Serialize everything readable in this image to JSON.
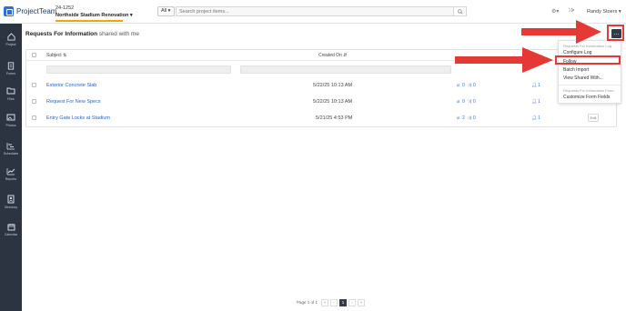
{
  "header": {
    "logo_text": "ProjectTeam",
    "project_number": "24-1252",
    "project_name": "Northside Stadium Renovation ▾",
    "search_scope": "All ▾",
    "search_placeholder": "Search project items...",
    "user_name": "Randy Stoers ▾"
  },
  "sidebar": {
    "items": [
      {
        "label": "Project",
        "icon": "home-icon"
      },
      {
        "label": "Forms",
        "icon": "document-icon"
      },
      {
        "label": "Files",
        "icon": "folder-icon"
      },
      {
        "label": "Photos",
        "icon": "image-icon"
      },
      {
        "label": "Schedules",
        "icon": "gantt-icon"
      },
      {
        "label": "Reports",
        "icon": "chart-icon"
      },
      {
        "label": "Directory",
        "icon": "contact-icon"
      },
      {
        "label": "Calendar",
        "icon": "calendar-icon"
      }
    ]
  },
  "page": {
    "title_strong": "Requests For Information",
    "title_light": "shared with me"
  },
  "table": {
    "columns": {
      "subject": "Subject ⇅",
      "created_on": "Created On ⇵"
    },
    "rows": [
      {
        "subject": "Exterior Concrete Slab",
        "created_on": "5/22/25 10:13 AM",
        "attachments": "0",
        "links": "0",
        "people": "1"
      },
      {
        "subject": "Request For New Specs",
        "created_on": "5/22/25 10:13 AM",
        "attachments": "0",
        "links": "0",
        "people": "1"
      },
      {
        "subject": "Entry Gate Locks at Stadium",
        "created_on": "5/21/25 4:53 PM",
        "attachments": "2",
        "links": "0",
        "people": "1",
        "edit": "Edit"
      }
    ]
  },
  "dropdown": {
    "section_log": "Requests For Information Log",
    "configure_log": "Configure Log",
    "follow": "Follow",
    "batch_import": "Batch Import",
    "view_shared": "View Shared With...",
    "section_form": "Requests For Information Form",
    "customize": "Customize Form Fields"
  },
  "pagination": {
    "label": "Page 1 of 1",
    "first": "«",
    "prev": "‹",
    "current": "1",
    "next": "›",
    "last": "»"
  },
  "colors": {
    "accent": "#2a64c8",
    "sidebar_bg": "#2b3440",
    "annotation_red": "#e53935",
    "project_underline": "#f0a800"
  }
}
